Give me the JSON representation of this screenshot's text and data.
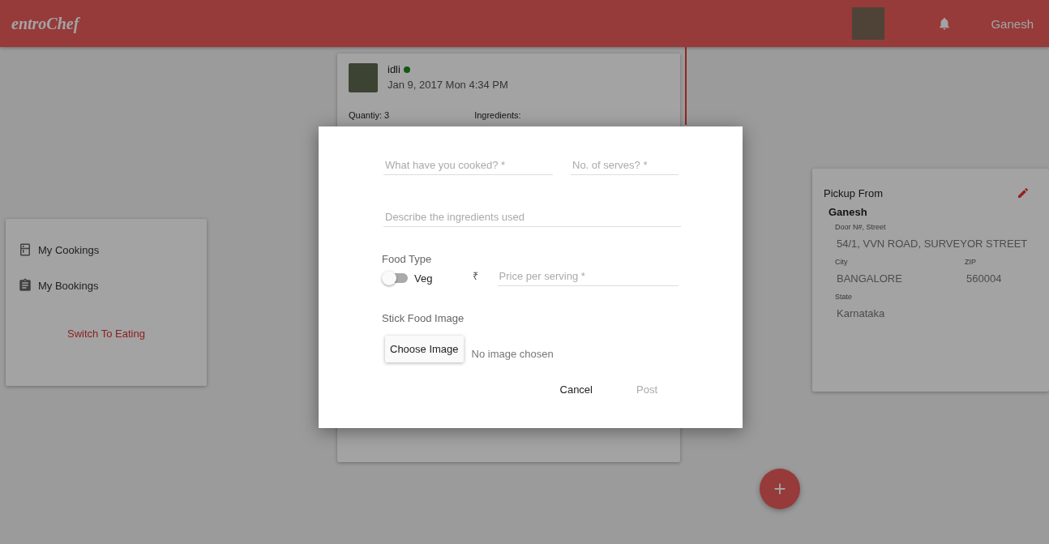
{
  "header": {
    "logo": "entroChef",
    "user_name": "Ganesh"
  },
  "sidebar": {
    "items": [
      {
        "label": "My Cookings",
        "kind": "cookings"
      },
      {
        "label": "My Bookings",
        "kind": "bookings"
      }
    ],
    "switch_link": "Switch To Eating"
  },
  "post_card": {
    "title": "idli",
    "date": "Jan 9, 2017 Mon 4:34 PM",
    "quantity": "Quantiy: 3",
    "ingredients_label": "Ingredients:"
  },
  "pickup": {
    "title": "Pickup From",
    "name": "Ganesh",
    "fields": [
      {
        "label": "Door N#, Street",
        "value": "54/1, VVN ROAD, SURVEYOR STREET"
      },
      {
        "label": "City",
        "value": "BANGALORE"
      },
      {
        "label": "ZIP",
        "value": "560004"
      },
      {
        "label": "State",
        "value": "Karnataka"
      }
    ]
  },
  "dialog": {
    "dish_field": {
      "placeholder": "What have you cooked? *"
    },
    "serves_field": {
      "placeholder": "No. of serves? *"
    },
    "ingredients_field": {
      "placeholder": "Describe the ingredients used"
    },
    "food_type": {
      "label": "Food Type",
      "toggle": {
        "label": "Veg",
        "on": false
      }
    },
    "currency": "₹",
    "price_field": {
      "placeholder": "Price per serving *"
    },
    "image_label": "Stick Food Image",
    "choose_button": "Choose Image",
    "image_status": "No image chosen",
    "buttons": [
      {
        "label": "Cancel",
        "disabled": false
      },
      {
        "label": "Post",
        "disabled": true
      }
    ]
  }
}
